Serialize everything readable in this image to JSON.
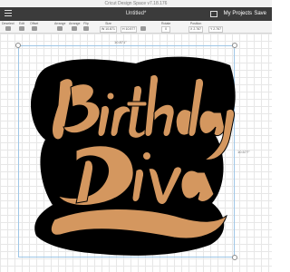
{
  "app": {
    "title": "Cricut Design Space  v7.18.176"
  },
  "header": {
    "document_title": "Untitled*",
    "my_projects": "My Projects",
    "save": "Save"
  },
  "toolbar": {
    "deselect": "Deselect",
    "edit": "Edit",
    "offset": "Offset",
    "align": "Arrange",
    "arrange": "Arrange",
    "flip": "Flip",
    "size": "Size",
    "w_label": "W",
    "w_value": "10.871",
    "h_label": "H",
    "h_value": "10.577",
    "rotate": "Rotate",
    "rotate_value": "0",
    "position": "Position",
    "x_label": "X",
    "x_value": "2.767",
    "y_label": "Y",
    "y_value": "2.767"
  },
  "canvas": {
    "dimension_width": "10.871\"",
    "dimension_height": "10.577\"",
    "artwork": {
      "line1": "Birthday",
      "line2": "Diva",
      "fill_color": "#d4975f",
      "outline_color": "#000000"
    }
  }
}
